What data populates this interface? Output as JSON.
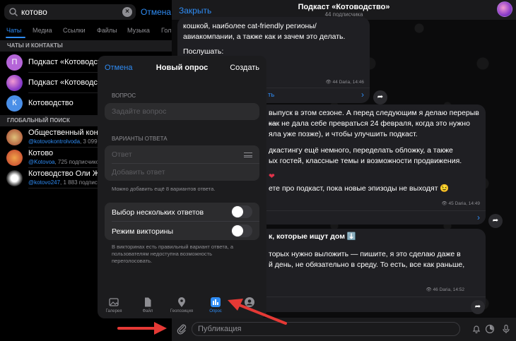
{
  "search": {
    "query": "котово",
    "cancel_label": "Отмена"
  },
  "tabs": [
    "Чаты",
    "Медиа",
    "Ссылки",
    "Файлы",
    "Музыка",
    "Гол"
  ],
  "sections": {
    "chats_contacts": "ЧАТЫ И КОНТАКТЫ",
    "global": "ГЛОБАЛЬНЫЙ ПОИСК"
  },
  "contacts": [
    {
      "avatar": "П",
      "title": "Подкаст «Котоводство»",
      "color": "#b565d8"
    },
    {
      "avatar": "",
      "title": "Подкаст «Котоводство»",
      "color": "#7a5bd0"
    },
    {
      "avatar": "К",
      "title": "Котоводство",
      "color": "#4a8fe7"
    }
  ],
  "global": [
    {
      "title": "Общественный контроль",
      "handle": "@kotovokontrolvoda",
      "rest": ", 3 099"
    },
    {
      "title": "Котово",
      "handle": "@Kotovoa",
      "rest": ", 725 подписчиков"
    },
    {
      "title": "Котоводство Оли Ж",
      "handle": "@kotovo247",
      "rest": ", 1 883 подписчика"
    }
  ],
  "chat": {
    "close_label": "Закрыть",
    "title": "Подкаст «Котоводство»",
    "subtitle": "44 подписчика",
    "msg1": {
      "line1": "кошкой, наиболее cat-friendly регионы/",
      "line2": "авиакомпании, а также как и зачем это делать.",
      "line3": "Послушать:",
      "meta": "44 Daria, 14:46",
      "link": "ть"
    },
    "msg2": {
      "lines": [
        "выпуск в этом сезоне. А перед следующим я делаю перерыв —",
        "как не дала себе превраться 24 февраля, когда это нужно",
        "яла уже позже), и чтобы улучшить подкаст.",
        "",
        "дкастингу ещё немного, переделать обложку, а также",
        "ых гостей, классные темы и возможности продвижения.",
        "",
        "ете про подкаст, пока новые эпизоды не выходят 😉"
      ],
      "heart": "❤",
      "meta": "45 Daria, 14:49"
    },
    "msg3": {
      "header": "к, которые ищут дом ⬇️",
      "lines": [
        "торых нужно выложить — пишите, я это сделаю даже в",
        "й день, не обязательно в среду. То есть, все как раньше,"
      ],
      "meta": "46 Daria, 14:52"
    },
    "input_placeholder": "Публикация"
  },
  "poll": {
    "cancel": "Отмена",
    "title": "Новый опрос",
    "create": "Создать",
    "question_label": "ВОПРОС",
    "question_placeholder": "Задайте вопрос",
    "answers_label": "ВАРИАНТЫ ОТВЕТА",
    "answer_placeholder": "Ответ",
    "add_answer": "Добавить ответ",
    "answers_note": "Можно добавить ещё 8 вариантов ответа.",
    "multiple": "Выбор нескольких ответов",
    "quiz": "Режим викторины",
    "quiz_note": "В викторинах есть правильный вариант ответа, а пользователям недоступна возможность переголосовать.",
    "multiple_on": false,
    "quiz_on": false
  },
  "attach": [
    {
      "label": "Галерея",
      "icon": "gallery-icon"
    },
    {
      "label": "Файл",
      "icon": "file-icon"
    },
    {
      "label": "Геопозиция",
      "icon": "location-icon"
    },
    {
      "label": "Опрос",
      "icon": "poll-icon",
      "active": true
    },
    {
      "label": "",
      "icon": "contact-icon"
    }
  ],
  "colors": {
    "accent": "#2f8cf4",
    "arrow": "#e53935"
  }
}
